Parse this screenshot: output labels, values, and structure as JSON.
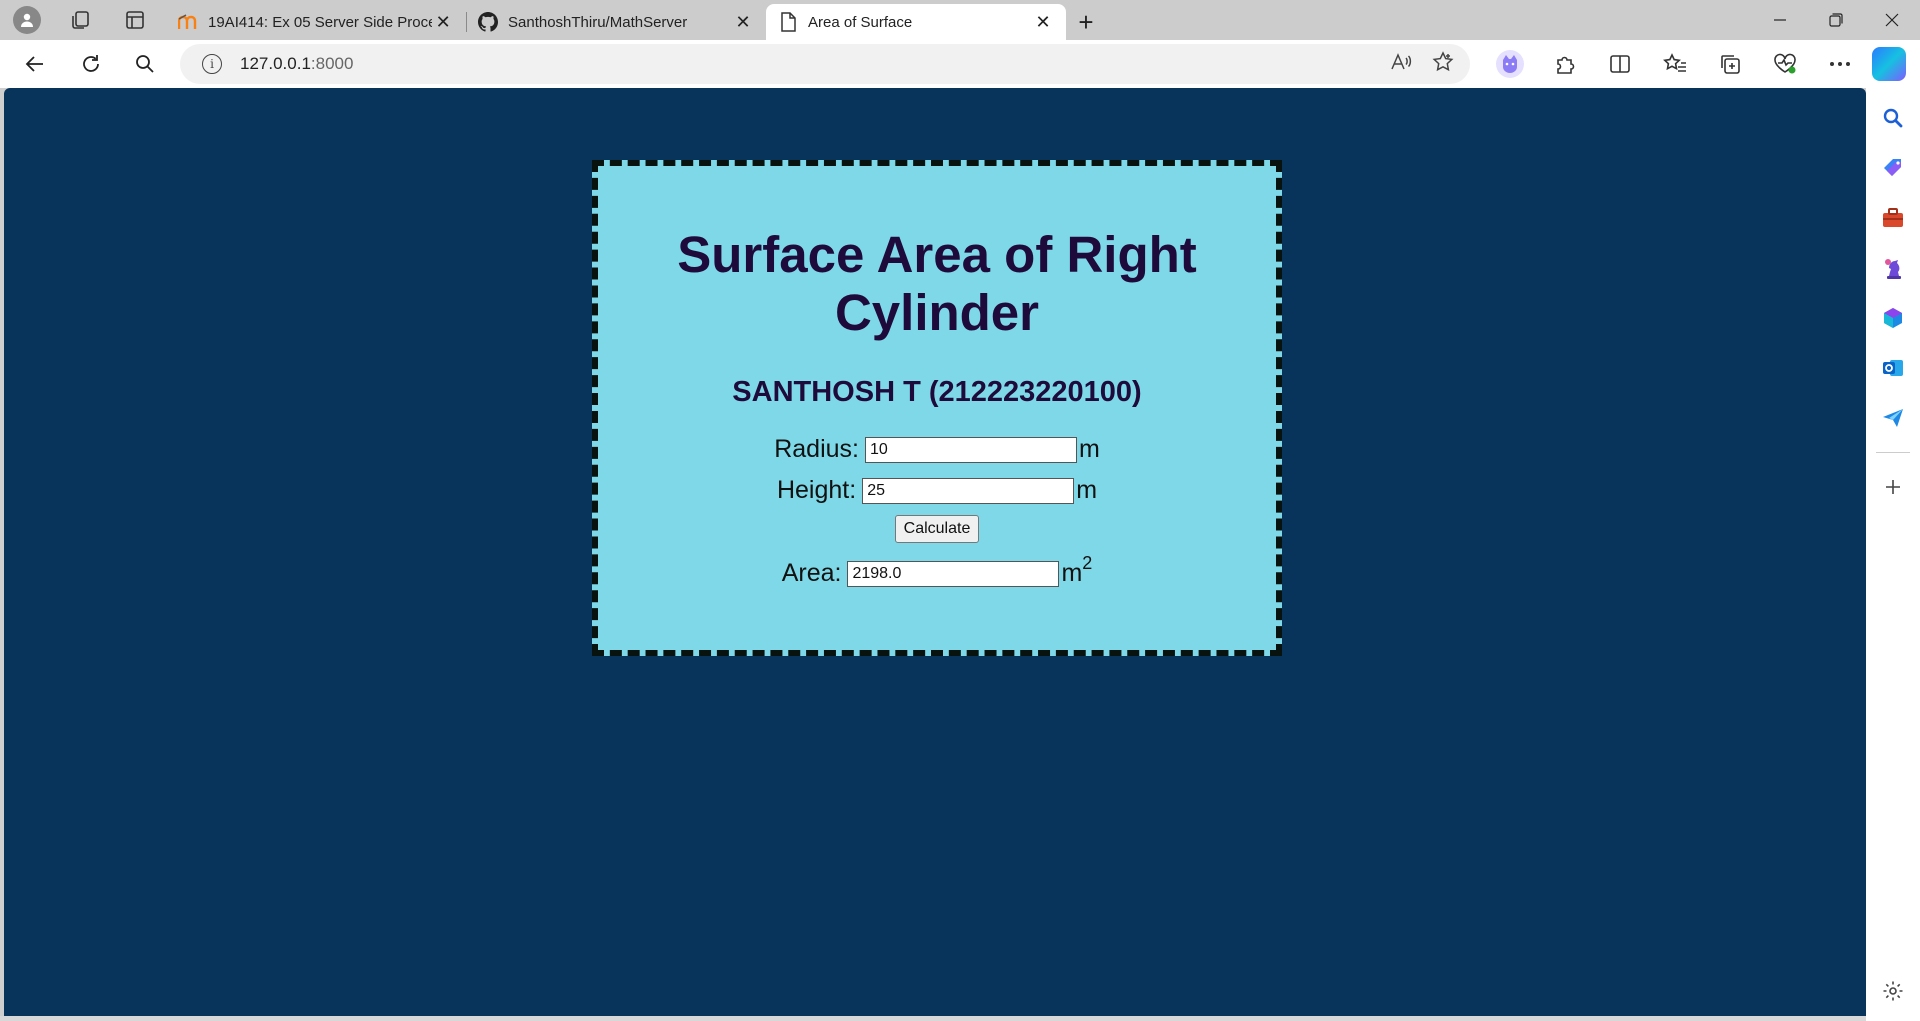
{
  "browser": {
    "tabs": [
      {
        "title": "19AI414: Ex 05 Server Side Proce",
        "favicon": "moodle-icon",
        "active": false
      },
      {
        "title": "SanthoshThiru/MathServer",
        "favicon": "github-icon",
        "active": false
      },
      {
        "title": "Area of Surface",
        "favicon": "page-icon",
        "active": true
      }
    ],
    "address": {
      "host": "127.0.0.1",
      "port": ":8000"
    }
  },
  "page": {
    "heading": "Surface Area of Right Cylinder",
    "subheading": "SANTHOSH T (212223220100)",
    "radius": {
      "label": "Radius:",
      "value": "10",
      "unit": "m"
    },
    "height": {
      "label": "Height:",
      "value": "25",
      "unit": "m"
    },
    "calculate_label": "Calculate",
    "area": {
      "label": "Area:",
      "value": "2198.0",
      "unit": "m",
      "unit_exp": "2"
    }
  },
  "colors": {
    "page_background": "#08345c",
    "card_background": "#7ed8e8",
    "heading_color": "#1e0b3b"
  }
}
